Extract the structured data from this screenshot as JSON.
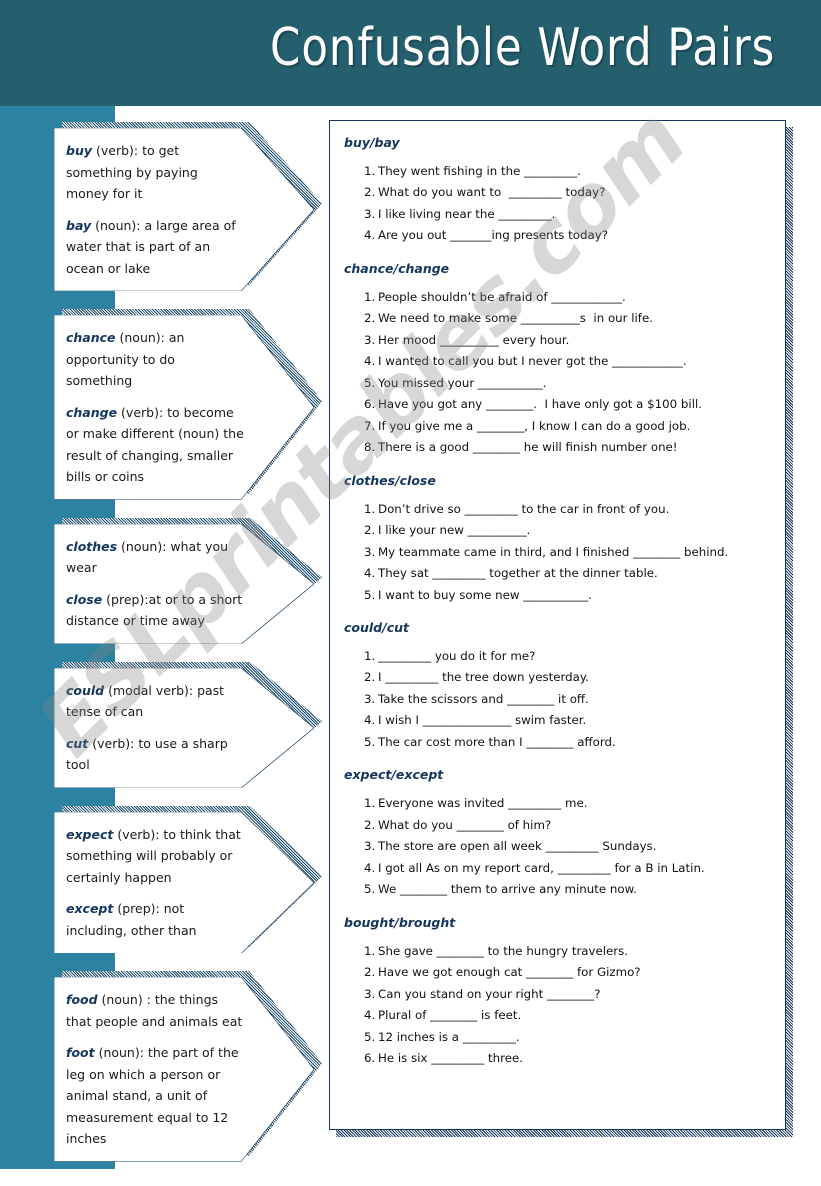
{
  "header": {
    "title": "Confusable Word Pairs"
  },
  "watermark": {
    "text": "ESLprintables.com"
  },
  "colors": {
    "header_band": "#255f6e",
    "left_stripe": "#2c82a0",
    "accent_dark": "#14365c",
    "panel_border": "#14365c",
    "text": "#111111",
    "watermark": "#828282"
  },
  "definitions": [
    {
      "id": "buy-bay",
      "entries": [
        {
          "word": "buy",
          "body": " (verb): to get something by paying money for it"
        },
        {
          "word": "bay",
          "body": " (noun): a large area of water that is part of an ocean or lake"
        }
      ]
    },
    {
      "id": "chance-change",
      "entries": [
        {
          "word": "chance",
          "body": " (noun):  an opportunity to do something"
        },
        {
          "word": "change",
          "body": " (verb): to become  or make different (noun) the result of changing, smaller bills or coins"
        }
      ]
    },
    {
      "id": "clothes-close",
      "entries": [
        {
          "word": "clothes",
          "body": " (noun): what you wear"
        },
        {
          "word": "close",
          "body": " (prep):at or to a short distance or time away"
        }
      ]
    },
    {
      "id": "could-cut",
      "entries": [
        {
          "word": "could",
          "body": " (modal verb): past tense of can"
        },
        {
          "word": "cut",
          "body": " (verb): to use a sharp tool"
        }
      ]
    },
    {
      "id": "expect-except",
      "entries": [
        {
          "word": "expect",
          "body": " (verb):  to think that something will probably or certainly happen"
        },
        {
          "word": "except",
          "body": " (prep): not including, other than"
        }
      ]
    },
    {
      "id": "food-foot",
      "entries": [
        {
          "word": "food",
          "body": " (noun) : the things that people and animals eat"
        },
        {
          "word": "foot",
          "body": " (noun): the part of the leg on which a person or animal stand, a unit of measurement equal  to 12 inches"
        }
      ]
    }
  ],
  "exercises": [
    {
      "id": "buy-bay",
      "heading": "buy/bay",
      "items": [
        {
          "num": "1.",
          "text": "They went fishing in the _________."
        },
        {
          "num": "2.",
          "text": "What do you want to  _________ today?"
        },
        {
          "num": "3.",
          "text": "I like living near the _________."
        },
        {
          "num": "4.",
          "text": "Are you out _______ing presents today?"
        }
      ]
    },
    {
      "id": "chance-change",
      "heading": "chance/change",
      "items": [
        {
          "num": "1.",
          "text": "People shouldn’t be afraid of ____________."
        },
        {
          "num": "2.",
          "text": "We need to make some __________s  in our life."
        },
        {
          "num": "3.",
          "text": "Her mood __________ every hour."
        },
        {
          "num": "4.",
          "text": "I wanted to call you but I never got the ____________."
        },
        {
          "num": "5.",
          "text": "You missed your ___________."
        },
        {
          "num": "6.",
          "text": "Have you got any ________.  I have only got a $100 bill."
        },
        {
          "num": "7.",
          "text": "If you give me a ________, I know I can do a good job."
        },
        {
          "num": "8.",
          "text": "There is a good ________ he will finish number one!"
        }
      ]
    },
    {
      "id": "clothes-close",
      "heading": "clothes/close",
      "items": [
        {
          "num": "1.",
          "text": "Don’t drive so _________ to the car in front of you."
        },
        {
          "num": "2.",
          "text": "I like your new __________."
        },
        {
          "num": "3.",
          "text": "My teammate came in third, and I finished ________ behind."
        },
        {
          "num": "4.",
          "text": "They sat _________ together at the dinner table."
        },
        {
          "num": "5.",
          "text": "I want to buy some new ___________."
        }
      ]
    },
    {
      "id": "could-cut",
      "heading": "could/cut",
      "items": [
        {
          "num": "1.",
          "text": "_________ you do it for me?"
        },
        {
          "num": "2.",
          "text": "I _________ the tree down yesterday."
        },
        {
          "num": "3.",
          "text": "Take the scissors and ________ it off."
        },
        {
          "num": "4.",
          "text": "I wish I _______________ swim faster."
        },
        {
          "num": "5.",
          "text": "The car cost more than I ________ afford."
        }
      ]
    },
    {
      "id": "expect-except",
      "heading": "expect/except",
      "items": [
        {
          "num": "1.",
          "text": "Everyone was invited _________ me."
        },
        {
          "num": "2.",
          "text": "What do you ________ of him?"
        },
        {
          "num": "3.",
          "text": "The store are open all week _________ Sundays."
        },
        {
          "num": "4.",
          "text": "I got all As on my report card, _________ for a B in Latin."
        },
        {
          "num": "5.",
          "text": "We ________ them to arrive any minute now."
        }
      ]
    },
    {
      "id": "bought-brought",
      "heading": "bought/brought",
      "items": [
        {
          "num": "1.",
          "text": "She gave ________ to the hungry travelers."
        },
        {
          "num": "2.",
          "text": "Have we got enough cat ________ for Gizmo?"
        },
        {
          "num": "3.",
          "text": "Can you stand on your right ________?"
        },
        {
          "num": "4.",
          "text": "Plural of ________ is feet."
        },
        {
          "num": "5.",
          "text": "12 inches is a _________."
        },
        {
          "num": "6.",
          "text": "He is six _________ three."
        }
      ]
    }
  ]
}
